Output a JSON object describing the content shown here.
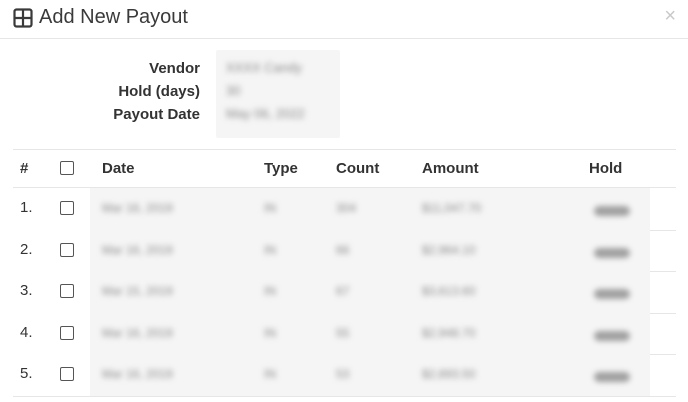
{
  "modal": {
    "title": "Add New Payout",
    "title_icon": "grid-icon",
    "close_glyph": "×"
  },
  "info": {
    "vendor_label": "Vendor",
    "hold_label": "Hold (days)",
    "payout_label": "Payout Date",
    "vendor_value": "XXXX Candy",
    "hold_value": "30",
    "payout_value": "May 06, 2022"
  },
  "table": {
    "headers": {
      "num": "#",
      "date": "Date",
      "type": "Type",
      "count": "Count",
      "amount": "Amount",
      "hold": "Hold"
    },
    "rows": [
      {
        "num": "1.",
        "date": "Mar 16, 2019",
        "type": "IN",
        "count": "304",
        "amount": "$11,047.70",
        "hold": "None"
      },
      {
        "num": "2.",
        "date": "Mar 16, 2019",
        "type": "IN",
        "count": "66",
        "amount": "$2,964.10",
        "hold": "None"
      },
      {
        "num": "3.",
        "date": "Mar 15, 2019",
        "type": "IN",
        "count": "67",
        "amount": "$3,613.60",
        "hold": "None"
      },
      {
        "num": "4.",
        "date": "Mar 16, 2019",
        "type": "IN",
        "count": "55",
        "amount": "$2,948.70",
        "hold": "None"
      },
      {
        "num": "5.",
        "date": "Mar 16, 2019",
        "type": "IN",
        "count": "53",
        "amount": "$2,893.50",
        "hold": "None"
      }
    ]
  }
}
